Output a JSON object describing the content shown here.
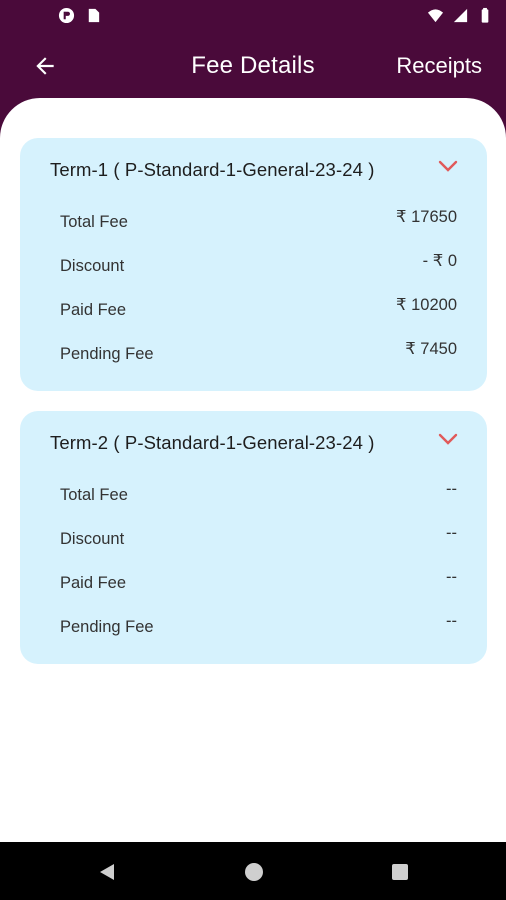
{
  "statusbar": {
    "left_icons": [
      "notification-app-icon",
      "sim-card-icon"
    ],
    "right_icons": [
      "wifi-icon",
      "signal-icon",
      "battery-icon"
    ]
  },
  "appbar": {
    "title": "Fee Details",
    "receipts_label": "Receipts",
    "back_icon": "arrow-left-icon"
  },
  "colors": {
    "primary": "#4a0a3a",
    "card_bg": "#d6f2fd",
    "chevron": "#e05a5a"
  },
  "terms": [
    {
      "title": "Term-1 ( P-Standard-1-General-23-24 )",
      "rows": [
        {
          "label": "Total Fee",
          "value": "₹ 17650"
        },
        {
          "label": "Discount",
          "value": "- ₹ 0"
        },
        {
          "label": "Paid Fee",
          "value": "₹ 10200"
        },
        {
          "label": "Pending Fee",
          "value": "₹ 7450"
        }
      ]
    },
    {
      "title": "Term-2 ( P-Standard-1-General-23-24 )",
      "rows": [
        {
          "label": "Total Fee",
          "value": "--"
        },
        {
          "label": "Discount",
          "value": "--"
        },
        {
          "label": "Paid Fee",
          "value": "--"
        },
        {
          "label": "Pending Fee",
          "value": "--"
        }
      ]
    }
  ],
  "navbar": {
    "icons": [
      "back-triangle-icon",
      "home-circle-icon",
      "recents-square-icon"
    ]
  }
}
